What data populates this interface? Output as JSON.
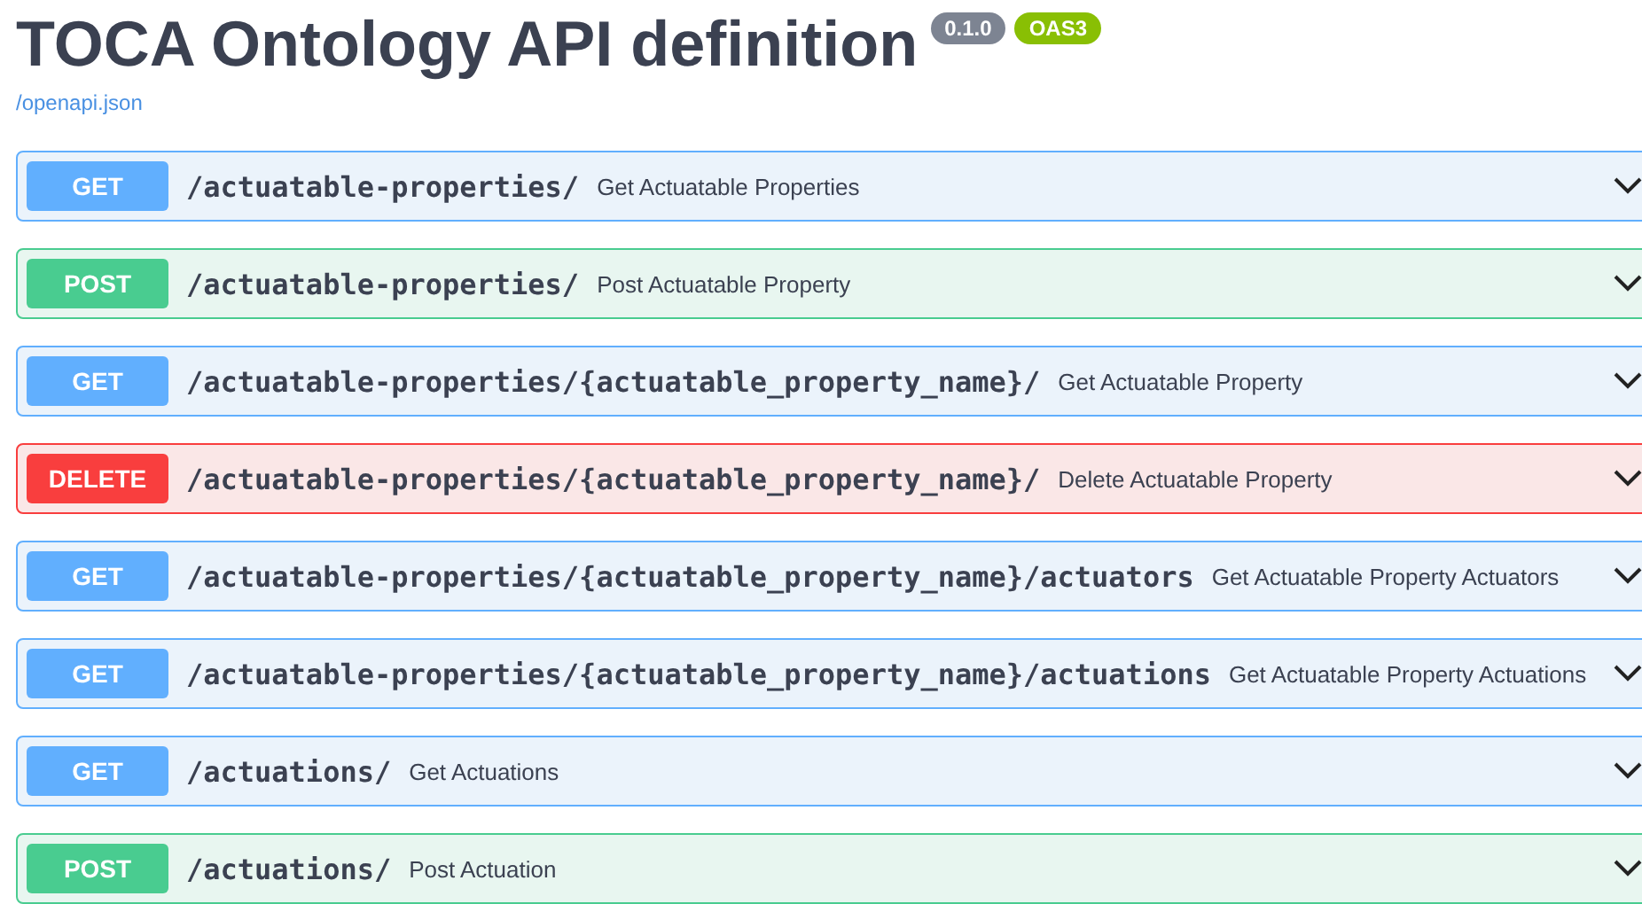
{
  "title": "TOCA Ontology API definition",
  "version_badge": "0.1.0",
  "spec_badge": "OAS3",
  "spec_link": "/openapi.json",
  "operations": [
    {
      "method": "GET",
      "path": "/actuatable-properties/",
      "summary": "Get Actuatable Properties"
    },
    {
      "method": "POST",
      "path": "/actuatable-properties/",
      "summary": "Post Actuatable Property"
    },
    {
      "method": "GET",
      "path": "/actuatable-properties/{actuatable_property_name}/",
      "summary": "Get Actuatable Property"
    },
    {
      "method": "DELETE",
      "path": "/actuatable-properties/{actuatable_property_name}/",
      "summary": "Delete Actuatable Property"
    },
    {
      "method": "GET",
      "path": "/actuatable-properties/{actuatable_property_name}/actuators",
      "summary": "Get Actuatable Property Actuators"
    },
    {
      "method": "GET",
      "path": "/actuatable-properties/{actuatable_property_name}/actuations",
      "summary": "Get Actuatable Property Actuations"
    },
    {
      "method": "GET",
      "path": "/actuations/",
      "summary": "Get Actuations"
    },
    {
      "method": "POST",
      "path": "/actuations/",
      "summary": "Post Actuation"
    }
  ]
}
